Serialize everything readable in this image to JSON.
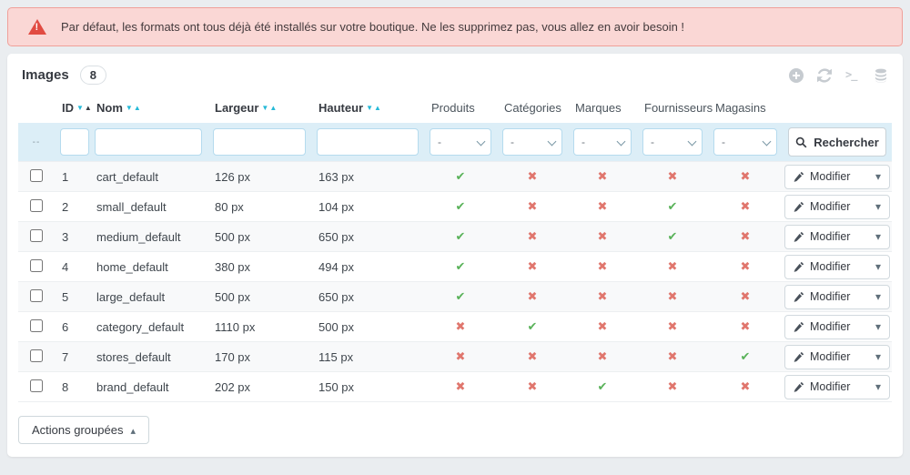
{
  "alert": {
    "text": "Par défaut, les formats ont tous déjà été installés sur votre boutique. Ne les supprimez pas, vous allez en avoir besoin !"
  },
  "panel": {
    "title": "Images",
    "count": "8",
    "toolbar_icons": [
      "plus-circle-icon",
      "refresh-icon",
      "terminal-icon",
      "database-icon"
    ]
  },
  "table": {
    "headers": [
      {
        "label": "ID",
        "sortable": true,
        "sort_class": "sorted-asc"
      },
      {
        "label": "Nom",
        "sortable": true,
        "sort_class": ""
      },
      {
        "label": "Largeur",
        "sortable": true,
        "sort_class": ""
      },
      {
        "label": "Hauteur",
        "sortable": true,
        "sort_class": ""
      },
      {
        "label": "Produits"
      },
      {
        "label": "Catégories"
      },
      {
        "label": "Marques"
      },
      {
        "label": "Fournisseurs"
      },
      {
        "label": "Magasins"
      }
    ],
    "filter": {
      "row_label": "--",
      "id_value": "",
      "name_value": "",
      "width_value": "",
      "height_value": "",
      "select_placeholder": "-",
      "search_label": "Rechercher"
    },
    "rows": [
      {
        "id": "1",
        "name": "cart_default",
        "width": "126 px",
        "height": "163 px",
        "flags": [
          "yes",
          "no",
          "no",
          "no",
          "no"
        ]
      },
      {
        "id": "2",
        "name": "small_default",
        "width": "80 px",
        "height": "104 px",
        "flags": [
          "yes",
          "no",
          "no",
          "yes",
          "no"
        ]
      },
      {
        "id": "3",
        "name": "medium_default",
        "width": "500 px",
        "height": "650 px",
        "flags": [
          "yes",
          "no",
          "no",
          "yes",
          "no"
        ]
      },
      {
        "id": "4",
        "name": "home_default",
        "width": "380 px",
        "height": "494 px",
        "flags": [
          "yes",
          "no",
          "no",
          "no",
          "no"
        ]
      },
      {
        "id": "5",
        "name": "large_default",
        "width": "500 px",
        "height": "650 px",
        "flags": [
          "yes",
          "no",
          "no",
          "no",
          "no"
        ]
      },
      {
        "id": "6",
        "name": "category_default",
        "width": "1110 px",
        "height": "500 px",
        "flags": [
          "no",
          "yes",
          "no",
          "no",
          "no"
        ]
      },
      {
        "id": "7",
        "name": "stores_default",
        "width": "170 px",
        "height": "115 px",
        "flags": [
          "no",
          "no",
          "no",
          "no",
          "yes"
        ]
      },
      {
        "id": "8",
        "name": "brand_default",
        "width": "202 px",
        "height": "150 px",
        "flags": [
          "no",
          "no",
          "yes",
          "no",
          "no"
        ]
      }
    ],
    "row_action_label": "Modifier"
  },
  "footer": {
    "bulk_actions_label": "Actions groupées"
  },
  "colors": {
    "accent_blue": "#25b9d7",
    "success_green": "#59b259",
    "danger_red": "#e0766d",
    "alert_bg": "#fad7d5",
    "alert_border": "#f0a099",
    "alert_icon": "#e14b42",
    "filter_row_bg": "#dceef7"
  }
}
